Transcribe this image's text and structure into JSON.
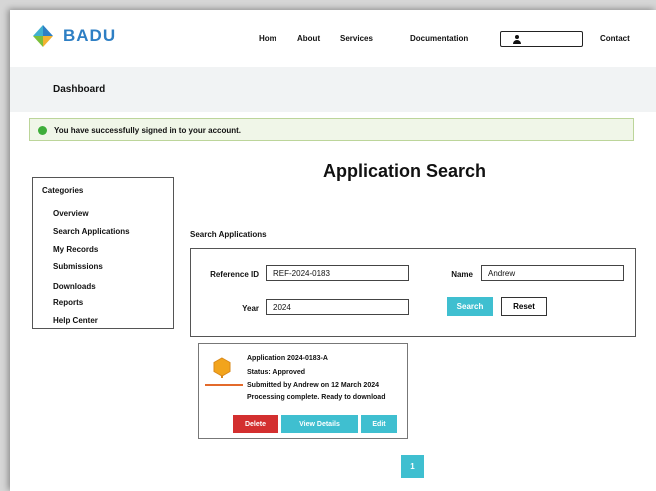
{
  "header": {
    "logo_text": "BADU",
    "nav": [
      "Home",
      "About",
      "Services",
      "Documentation",
      "Contact"
    ],
    "account_icon": "user-icon"
  },
  "banner": {
    "title": "Dashboard"
  },
  "alert": {
    "icon": "check-circle-icon",
    "message": "You have successfully signed in to your account."
  },
  "sidebar": {
    "title": "Categories",
    "items": [
      "Overview",
      "Search Applications",
      "My Records",
      "Submissions",
      "Downloads",
      "Reports",
      "Help Center"
    ]
  },
  "main": {
    "title": "Application Search",
    "section_label": "Search Applications",
    "form": {
      "field1": {
        "label": "Reference ID",
        "value": "REF-2024-0183"
      },
      "field2": {
        "label": "Name",
        "value": "Andrew"
      },
      "field3": {
        "label": "Year",
        "value": "2024"
      },
      "search_label": "Search",
      "clear_label": "Reset"
    },
    "result_card": {
      "icon": "hexagon-badge-icon",
      "title": "Application 2024-0183-A",
      "line2": "Status: Approved",
      "line3": "Submitted by Andrew on 12 March 2024",
      "line4": "Processing complete. Ready to download",
      "buttons": {
        "delete": "Delete",
        "view": "View Details",
        "edit": "Edit"
      }
    }
  },
  "pagination": {
    "current": "1"
  },
  "colors": {
    "accent": "#3fbfd0",
    "danger": "#d32f2f",
    "success": "#3fae3a",
    "logo": "#2e7fc4"
  }
}
